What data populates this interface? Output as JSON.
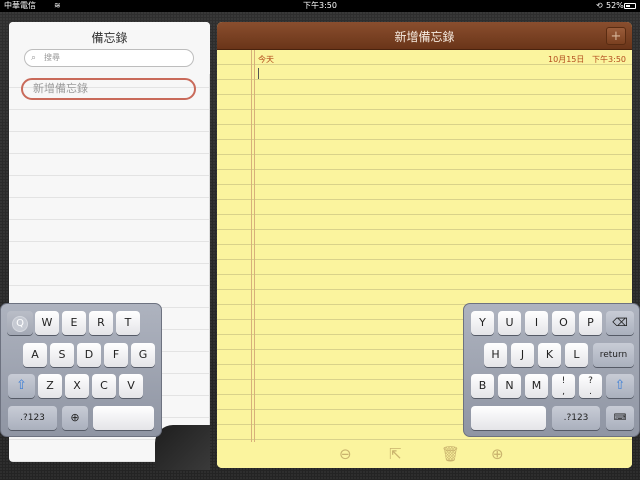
{
  "status_bar": {
    "carrier": "中華電信",
    "wifi_icon": "wifi-icon",
    "time": "下午3:50",
    "lock_icon": "lock-rotation-icon",
    "battery_percent": "52%",
    "battery_level": 0.52
  },
  "notes_list": {
    "title": "備忘錄",
    "search_placeholder": "搜尋",
    "items": [
      {
        "label": "新增備忘錄"
      }
    ]
  },
  "note": {
    "title": "新增備忘錄",
    "add_button": "+",
    "day_label": "今天",
    "date": "10月15日",
    "time": "下午3:50",
    "content": "",
    "footer_icons": [
      "previous-arrow-icon",
      "share-icon",
      "trash-icon",
      "next-arrow-icon"
    ]
  },
  "keyboard_left": {
    "row1": [
      "Q",
      "W",
      "E",
      "R",
      "T"
    ],
    "row2": [
      "A",
      "S",
      "D",
      "F",
      "G"
    ],
    "row3": [
      "Z",
      "X",
      "C",
      "V"
    ],
    "numbers_key": ".?123",
    "globe_icon": "globe-icon",
    "shift_icon": "shift-icon"
  },
  "keyboard_right": {
    "row1": [
      "Y",
      "U",
      "I",
      "O",
      "P"
    ],
    "row2": [
      "H",
      "J",
      "K",
      "L"
    ],
    "row3": [
      "B",
      "N",
      "M",
      "!",
      "?"
    ],
    "row3_alt": [
      ",",
      "."
    ],
    "return_key": "return",
    "numbers_key": ".?123",
    "backspace_icon": "backspace-icon",
    "shift_icon": "shift-icon",
    "hide_keyboard_icon": "hide-keyboard-icon"
  }
}
